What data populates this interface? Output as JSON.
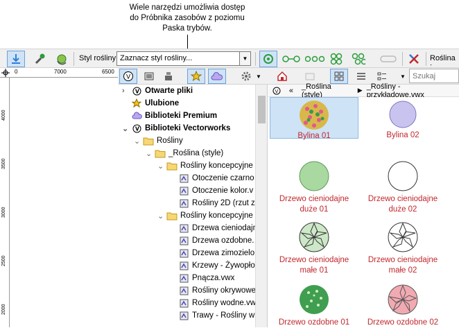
{
  "callout": {
    "line1": "Wiele narzędzi umożliwia dostęp",
    "line2": "do Próbnika zasobów z poziomu",
    "line3": "Paska trybów."
  },
  "modebar": {
    "style_label": "Styl rośliny:",
    "style_value": "Zaznacz styl rośliny...",
    "plant_label": "Roślina :"
  },
  "ruler": {
    "t1": "0",
    "t2": "7000",
    "t3": "6500",
    "v1": "4000",
    "v2": "3500",
    "v3": "3000",
    "v4": "2500",
    "v5": "2000"
  },
  "search": {
    "placeholder": "Szukaj"
  },
  "tree": [
    {
      "label": "Otwarte pliki",
      "bold": true,
      "indent": 0,
      "icon": "v-icon",
      "arrow": "›"
    },
    {
      "label": "Ulubione",
      "bold": true,
      "indent": 0,
      "icon": "star-icon",
      "arrow": ""
    },
    {
      "label": "Biblioteki Premium",
      "bold": true,
      "indent": 0,
      "icon": "cloud-icon",
      "arrow": ""
    },
    {
      "label": "Biblioteki Vectorworks",
      "bold": true,
      "indent": 0,
      "icon": "v-icon",
      "arrow": "⌄"
    },
    {
      "label": "Rośliny",
      "bold": false,
      "indent": 1,
      "icon": "folder-icon",
      "arrow": "⌄"
    },
    {
      "label": "_Roślina (style)",
      "bold": false,
      "indent": 2,
      "icon": "folder-icon",
      "arrow": "⌄"
    },
    {
      "label": "Rośliny koncepcyjne",
      "bold": false,
      "indent": 3,
      "icon": "folder-icon",
      "arrow": "⌄"
    },
    {
      "label": "Otoczenie czarno",
      "bold": false,
      "indent": 4,
      "icon": "file-icon",
      "arrow": ""
    },
    {
      "label": "Otoczenie kolor.v",
      "bold": false,
      "indent": 4,
      "icon": "file-icon",
      "arrow": ""
    },
    {
      "label": "Rośliny 2D (rzut z",
      "bold": false,
      "indent": 4,
      "icon": "file-icon",
      "arrow": ""
    },
    {
      "label": "Rośliny koncepcyjne",
      "bold": false,
      "indent": 3,
      "icon": "folder-icon",
      "arrow": "⌄"
    },
    {
      "label": "Drzewa cieniodajn",
      "bold": false,
      "indent": 4,
      "icon": "file-icon",
      "arrow": ""
    },
    {
      "label": "Drzewa ozdobne.",
      "bold": false,
      "indent": 4,
      "icon": "file-icon",
      "arrow": ""
    },
    {
      "label": "Drzewa zimozielo",
      "bold": false,
      "indent": 4,
      "icon": "file-icon",
      "arrow": ""
    },
    {
      "label": "Krzewy - Żywopło",
      "bold": false,
      "indent": 4,
      "icon": "file-icon",
      "arrow": ""
    },
    {
      "label": "Pnącza.vwx",
      "bold": false,
      "indent": 4,
      "icon": "file-icon",
      "arrow": ""
    },
    {
      "label": "Rośliny okrywowe",
      "bold": false,
      "indent": 4,
      "icon": "file-icon",
      "arrow": ""
    },
    {
      "label": "Rośliny wodne.vw",
      "bold": false,
      "indent": 4,
      "icon": "file-icon",
      "arrow": ""
    },
    {
      "label": "Trawy - Rośliny wi",
      "bold": false,
      "indent": 4,
      "icon": "file-icon",
      "arrow": ""
    }
  ],
  "path": {
    "back": "«",
    "seg1": "_Roślina (style)",
    "sep": "▶",
    "seg2": "_Rośliny - przykładowe.vwx"
  },
  "items": [
    {
      "l1": "Bylina 01",
      "l2": "",
      "icon": "bylina-01-icon",
      "selected": true
    },
    {
      "l1": "Bylina 02",
      "l2": "",
      "icon": "bylina-02-icon",
      "selected": false
    },
    {
      "l1": "Drzewo cieniodajne",
      "l2": "duże 01",
      "icon": "drzewo-cieniodajne-duze-01-icon",
      "selected": false
    },
    {
      "l1": "Drzewo cieniodajne",
      "l2": "duże 02",
      "icon": "drzewo-cieniodajne-duze-02-icon",
      "selected": false
    },
    {
      "l1": "Drzewo cieniodajne",
      "l2": "małe 01",
      "icon": "drzewo-cieniodajne-male-01-icon",
      "selected": false
    },
    {
      "l1": "Drzewo cieniodajne",
      "l2": "małe 02",
      "icon": "drzewo-cieniodajne-male-02-icon",
      "selected": false
    },
    {
      "l1": "Drzewo ozdobne 01",
      "l2": "",
      "icon": "drzewo-ozdobne-01-icon",
      "selected": false
    },
    {
      "l1": "Drzewo ozdobne 02",
      "l2": "",
      "icon": "drzewo-ozdobne-02-icon",
      "selected": false
    }
  ],
  "colors": {
    "accent": "#2f7ed8",
    "label_red": "#c1272d",
    "selected_bg": "#cfe3f7"
  }
}
